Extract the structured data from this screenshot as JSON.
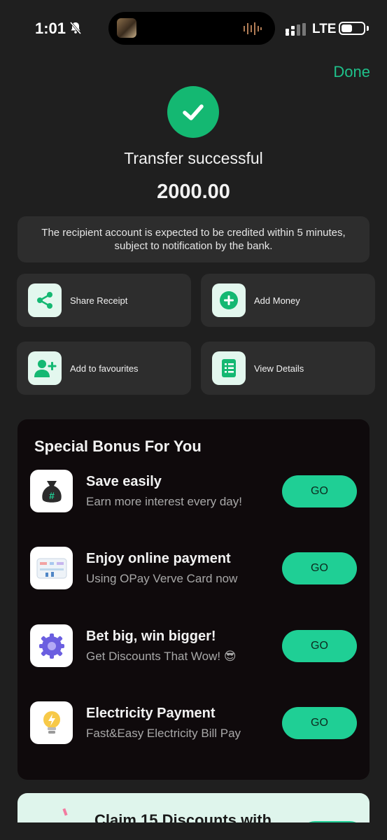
{
  "status_bar": {
    "time": "1:01",
    "network": "LTE"
  },
  "header": {
    "done_label": "Done"
  },
  "result": {
    "title": "Transfer successful",
    "amount": "2000.00",
    "notice": "The recipient account is expected to be credited within 5 minutes, subject to notification by the bank."
  },
  "actions": {
    "share_receipt": "Share Receipt",
    "add_money": "Add Money",
    "add_favourites": "Add to favourites",
    "view_details": "View Details"
  },
  "bonus": {
    "title": "Special Bonus For You",
    "items": [
      {
        "name": "Save easily",
        "desc": "Earn more interest every day!",
        "button": "GO",
        "icon": "money-bag-icon"
      },
      {
        "name": "Enjoy online payment",
        "desc": "Using OPay Verve Card now",
        "button": "GO",
        "icon": "card-icon"
      },
      {
        "name": "Bet big, win bigger!",
        "desc": "Get Discounts That Wow! 😎",
        "button": "GO",
        "icon": "gear-ball-icon"
      },
      {
        "name": "Electricity Payment",
        "desc": "Fast&Easy Electricity Bill Pay",
        "button": "GO",
        "icon": "lightbulb-icon"
      }
    ]
  },
  "promo": {
    "text": "Claim 15 Discounts with"
  },
  "colors": {
    "accent": "#1fcf95",
    "success": "#14b872",
    "background": "#1f1f1f",
    "card": "#2d2d2d",
    "panel": "#0f0a0c"
  }
}
